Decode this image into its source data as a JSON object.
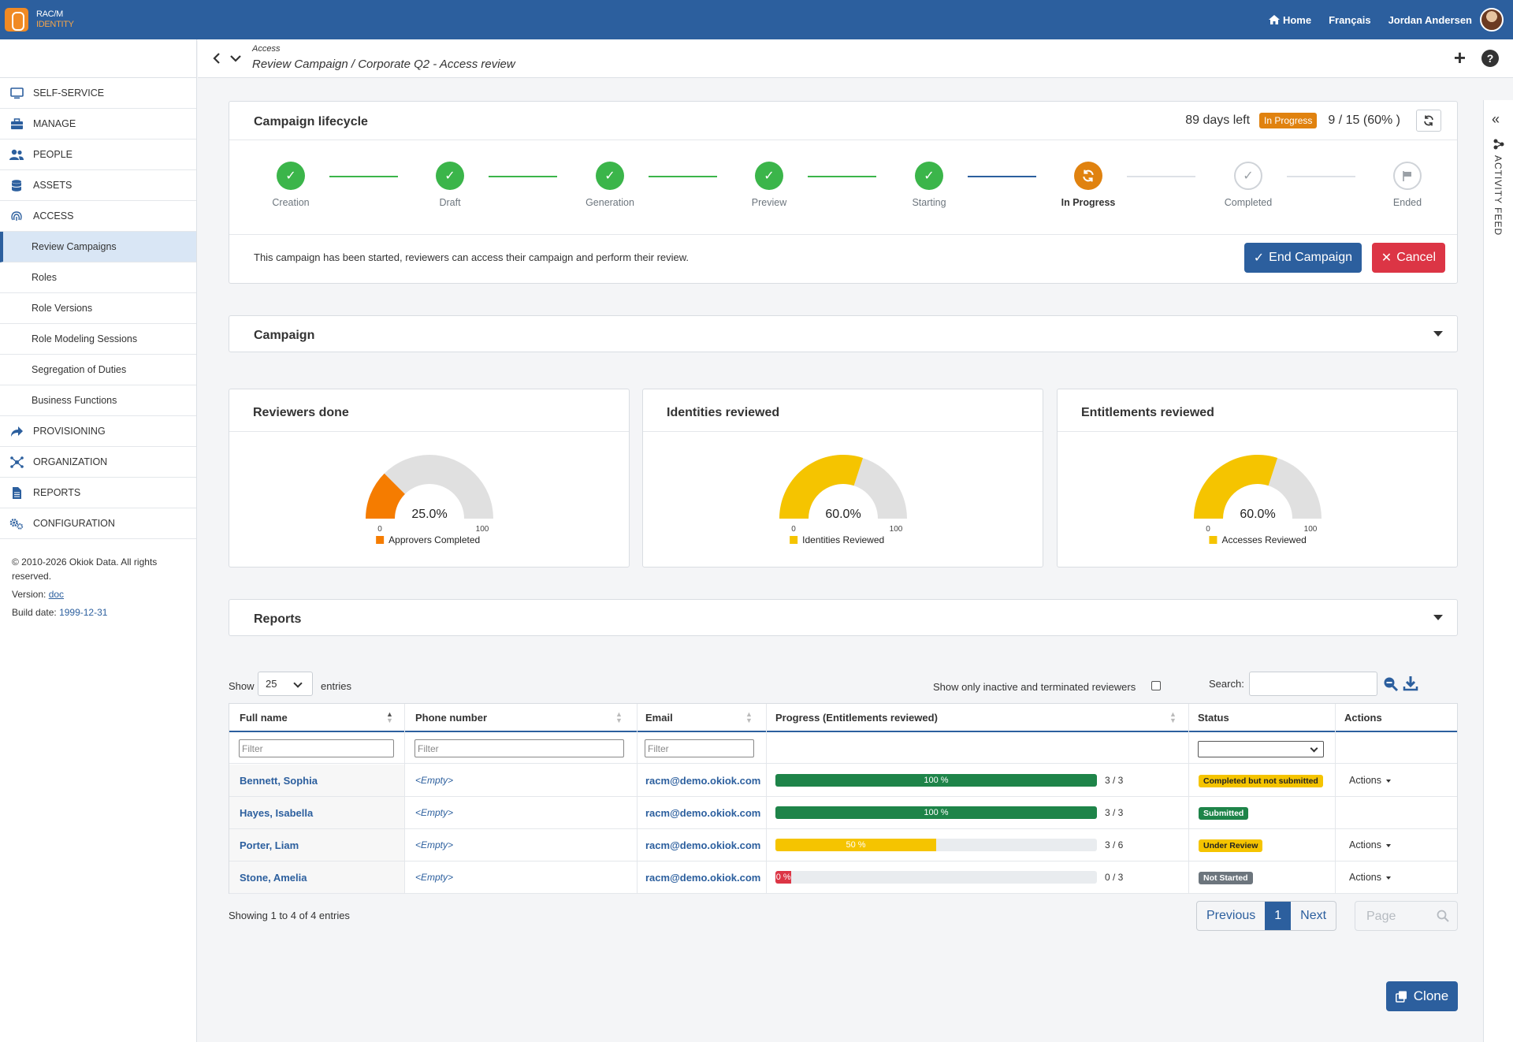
{
  "app": {
    "logo_line1": "RAC/M",
    "logo_line2": "IDENTITY",
    "nav": {
      "home": "Home",
      "language": "Français",
      "user": "Jordan Andersen"
    }
  },
  "header": {
    "breadcrumb": "Access",
    "title": "Review Campaign / Corporate Q2 - Access review"
  },
  "sidebar": {
    "items": [
      {
        "label": "SELF-SERVICE",
        "icon": "monitor-icon"
      },
      {
        "label": "MANAGE",
        "icon": "toolbox-icon"
      },
      {
        "label": "PEOPLE",
        "icon": "users-icon"
      },
      {
        "label": "ASSETS",
        "icon": "database-icon"
      },
      {
        "label": "ACCESS",
        "icon": "fingerprint-icon"
      }
    ],
    "access_sub": [
      "Review Campaigns",
      "Roles",
      "Role Versions",
      "Role Modeling Sessions",
      "Segregation of Duties",
      "Business Functions"
    ],
    "items2": [
      {
        "label": "PROVISIONING",
        "icon": "share-icon"
      },
      {
        "label": "ORGANIZATION",
        "icon": "network-icon"
      },
      {
        "label": "REPORTS",
        "icon": "file-icon"
      },
      {
        "label": "CONFIGURATION",
        "icon": "cogs-icon"
      }
    ],
    "footer": {
      "copyright": "© 2010-2026 Okiok Data. All rights reserved.",
      "version_label": "Version:",
      "version_link": "doc",
      "build_label": "Build date:",
      "build_date": "1999-12-31"
    }
  },
  "activity_feed": {
    "label": "ACTIVITY FEED"
  },
  "lifecycle": {
    "title": "Campaign lifecycle",
    "days_left": "89 days left",
    "status": "In Progress",
    "fraction": "9 / 15 (60% )",
    "steps": [
      {
        "label": "Creation",
        "state": "done"
      },
      {
        "label": "Draft",
        "state": "done"
      },
      {
        "label": "Generation",
        "state": "done"
      },
      {
        "label": "Preview",
        "state": "done"
      },
      {
        "label": "Starting",
        "state": "done"
      },
      {
        "label": "In Progress",
        "state": "current"
      },
      {
        "label": "Completed",
        "state": "todo"
      },
      {
        "label": "Ended",
        "state": "todo"
      }
    ],
    "message": "This campaign has been started, reviewers can access their campaign and perform their review.",
    "end_label": "End Campaign",
    "cancel_label": "Cancel"
  },
  "campaign_panel": {
    "title": "Campaign"
  },
  "gauges": [
    {
      "title": "Reviewers done",
      "value": 25.0,
      "display": "25.0%",
      "min": "0",
      "max": "100",
      "legend": "Approvers Completed",
      "color": "#f57c00"
    },
    {
      "title": "Identities reviewed",
      "value": 60.0,
      "display": "60.0%",
      "min": "0",
      "max": "100",
      "legend": "Identities Reviewed",
      "color": "#f5c400"
    },
    {
      "title": "Entitlements reviewed",
      "value": 60.0,
      "display": "60.0%",
      "min": "0",
      "max": "100",
      "legend": "Accesses Reviewed",
      "color": "#f5c400"
    }
  ],
  "reports_panel": {
    "title": "Reports"
  },
  "table": {
    "show_label": "Show",
    "page_size": "25",
    "entries_label": "entries",
    "inactive_label": "Show only inactive and terminated reviewers",
    "search_label": "Search:",
    "columns": [
      "Full name",
      "Phone number",
      "Email",
      "Progress (Entitlements reviewed)",
      "Status",
      "Actions"
    ],
    "filter_placeholder": "Filter",
    "rows": [
      {
        "name": "Bennett, Sophia",
        "phone": "<Empty>",
        "email": "racm@demo.okiok.com",
        "progress": 100,
        "progress_label": "100 %",
        "count": "3 / 3",
        "status": "Completed but not submitted",
        "status_bg": "#f5c400",
        "status_fg": "#222",
        "bar": "#1e8449",
        "actions": "Actions"
      },
      {
        "name": "Hayes, Isabella",
        "phone": "<Empty>",
        "email": "racm@demo.okiok.com",
        "progress": 100,
        "progress_label": "100 %",
        "count": "3 / 3",
        "status": "Submitted",
        "status_bg": "#1e8449",
        "status_fg": "#fff",
        "bar": "#1e8449",
        "actions": ""
      },
      {
        "name": "Porter, Liam",
        "phone": "<Empty>",
        "email": "racm@demo.okiok.com",
        "progress": 50,
        "progress_label": "50 %",
        "count": "3 / 6",
        "status": "Under Review",
        "status_bg": "#f5c400",
        "status_fg": "#222",
        "bar": "#f5c400",
        "actions": "Actions"
      },
      {
        "name": "Stone, Amelia",
        "phone": "<Empty>",
        "email": "racm@demo.okiok.com",
        "progress": 0,
        "progress_label": "0 %",
        "count": "0 / 3",
        "status": "Not Started",
        "status_bg": "#6c757d",
        "status_fg": "#fff",
        "bar": "#dc3545",
        "actions": "Actions"
      }
    ],
    "info": "Showing 1 to 4 of 4 entries",
    "prev": "Previous",
    "page": "1",
    "next": "Next",
    "page_placeholder": "Page"
  },
  "clone_label": "Clone"
}
